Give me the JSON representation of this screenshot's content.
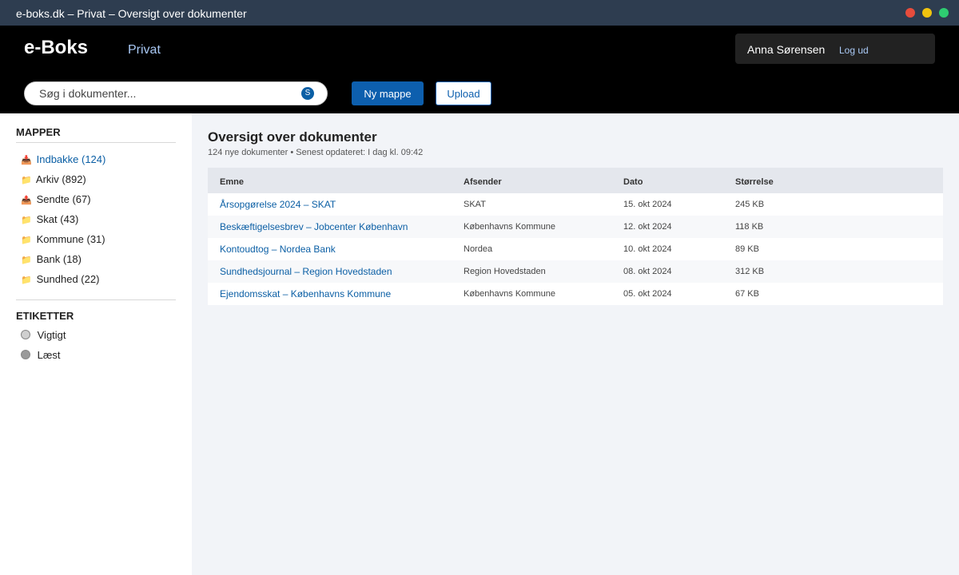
{
  "window": {
    "title": "e-boks.dk – Privat – Oversigt over dokumenter"
  },
  "header": {
    "logo": "e-Boks",
    "nav_private": "Privat",
    "user_name": "Anna Sørensen",
    "logout": "Log ud",
    "search_placeholder": "Søg i dokumenter...",
    "search_icon_glyph": "S",
    "new_folder_label": "Ny mappe",
    "upload_label": "Upload"
  },
  "sidebar": {
    "folders_heading": "MAPPER",
    "folders": [
      {
        "icon": "inbox-icon",
        "glyph": "📥",
        "label": "Indbakke (124)"
      },
      {
        "icon": "folder-icon",
        "glyph": "📁",
        "label": "Arkiv (892)"
      },
      {
        "icon": "sent-icon",
        "glyph": "📤",
        "label": "Sendte (67)"
      },
      {
        "icon": "folder-icon",
        "glyph": "📁",
        "label": "Skat (43)"
      },
      {
        "icon": "folder-icon",
        "glyph": "📁",
        "label": "Kommune (31)"
      },
      {
        "icon": "folder-icon",
        "glyph": "📁",
        "label": "Bank (18)"
      },
      {
        "icon": "folder-icon",
        "glyph": "📁",
        "label": "Sundhed (22)"
      }
    ],
    "tags_heading": "ETIKETTER",
    "tags": [
      {
        "label": "Vigtigt",
        "color": "#cfcfcf"
      },
      {
        "label": "Læst",
        "color": "#9a9a9a"
      }
    ]
  },
  "main": {
    "title": "Oversigt over dokumenter",
    "subtitle": "124 nye dokumenter • Senest opdateret: I dag kl. 09:42",
    "columns": [
      "Emne",
      "Afsender",
      "Dato",
      "Størrelse"
    ],
    "rows": [
      [
        "Årsopgørelse 2024 – SKAT",
        "SKAT",
        "15. okt 2024",
        "245 KB"
      ],
      [
        "Beskæftigelsesbrev – Jobcenter København",
        "Københavns Kommune",
        "12. okt 2024",
        "118 KB"
      ],
      [
        "Kontoudtog – Nordea Bank",
        "Nordea",
        "10. okt 2024",
        "89 KB"
      ],
      [
        "Sundhedsjournal – Region Hovedstaden",
        "Region Hovedstaden",
        "08. okt 2024",
        "312 KB"
      ],
      [
        "Ejendomsskat – Københavns Kommune",
        "Københavns Kommune",
        "05. okt 2024",
        "67 KB"
      ]
    ]
  },
  "colors": {
    "accent": "#0d5fae",
    "header_bg": "#000000",
    "titlebar_bg": "#2e3d50",
    "main_bg": "#f2f4f8"
  }
}
